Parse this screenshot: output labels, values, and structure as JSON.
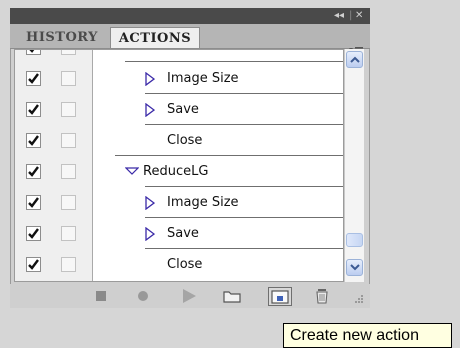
{
  "titlebar": {
    "collapse_glyph": "◂◂",
    "separator": "|",
    "close_glyph": "✕"
  },
  "tabs": [
    {
      "label": "HISTORY",
      "active": false
    },
    {
      "label": "ACTIONS",
      "active": true
    }
  ],
  "panel_menu_icon": "panel-menu-icon",
  "rows": [
    {
      "checked": true,
      "type": "command",
      "label": "Image Size",
      "expandable": true,
      "expanded": false
    },
    {
      "checked": true,
      "type": "command",
      "label": "Save",
      "expandable": true,
      "expanded": false
    },
    {
      "checked": true,
      "type": "command",
      "label": "Close",
      "expandable": false
    },
    {
      "checked": true,
      "type": "action",
      "label": "ReduceLG",
      "expandable": true,
      "expanded": true
    },
    {
      "checked": true,
      "type": "command",
      "label": "Image Size",
      "expandable": true,
      "expanded": false
    },
    {
      "checked": true,
      "type": "command",
      "label": "Save",
      "expandable": true,
      "expanded": false
    },
    {
      "checked": true,
      "type": "command",
      "label": "Close",
      "expandable": false
    }
  ],
  "bottom_toolbar": [
    {
      "icon": "stop-icon"
    },
    {
      "icon": "record-icon"
    },
    {
      "icon": "play-icon"
    },
    {
      "icon": "new-set-folder-icon"
    },
    {
      "icon": "new-action-icon",
      "selected": true
    },
    {
      "icon": "trash-icon"
    }
  ],
  "tooltip": "Create new action",
  "colors": {
    "titlebar": "#4a4a4a",
    "panel": "#cfcfcf",
    "tooltip_bg": "#ffffe1",
    "expand_triangle": "#3b2aa8",
    "scroll_accent": "#bccdf0"
  }
}
